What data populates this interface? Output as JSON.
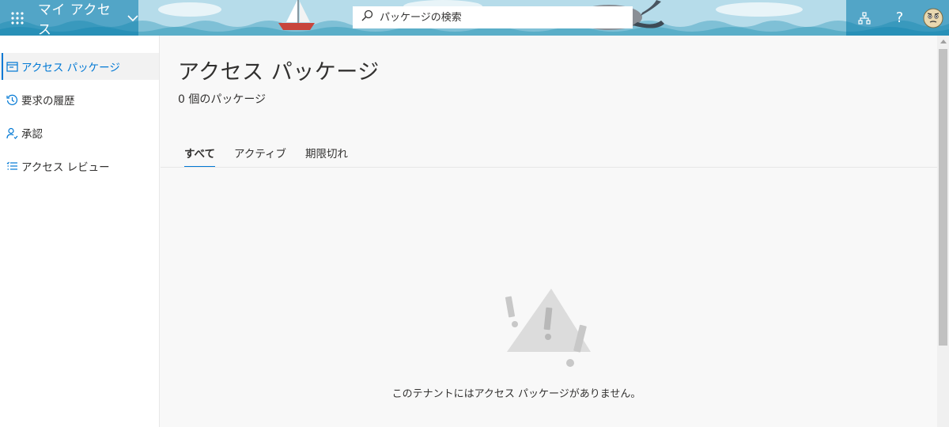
{
  "header": {
    "app_title": "マイ アクセス",
    "search_placeholder": "パッケージの検索",
    "help_label": "?",
    "icons": [
      "waffle-icon",
      "chevron-down-icon",
      "search-icon",
      "org-chart-icon",
      "help-icon",
      "avatar"
    ],
    "theme_color": "#a5d4e6"
  },
  "sidebar": {
    "items": [
      {
        "label": "アクセス パッケージ",
        "icon": "package-icon",
        "active": true
      },
      {
        "label": "要求の履歴",
        "icon": "history-icon",
        "active": false
      },
      {
        "label": "承認",
        "icon": "person-check-icon",
        "active": false
      },
      {
        "label": "アクセス レビュー",
        "icon": "review-list-icon",
        "active": false
      }
    ]
  },
  "main": {
    "title": "アクセス パッケージ",
    "count_text": "0 個のパッケージ",
    "tabs": [
      {
        "label": "すべて",
        "active": true
      },
      {
        "label": "アクティブ",
        "active": false
      },
      {
        "label": "期限切れ",
        "active": false
      }
    ],
    "empty_message": "このテナントにはアクセス パッケージがありません。"
  },
  "colors": {
    "accent": "#0078d4",
    "text": "#323130"
  }
}
